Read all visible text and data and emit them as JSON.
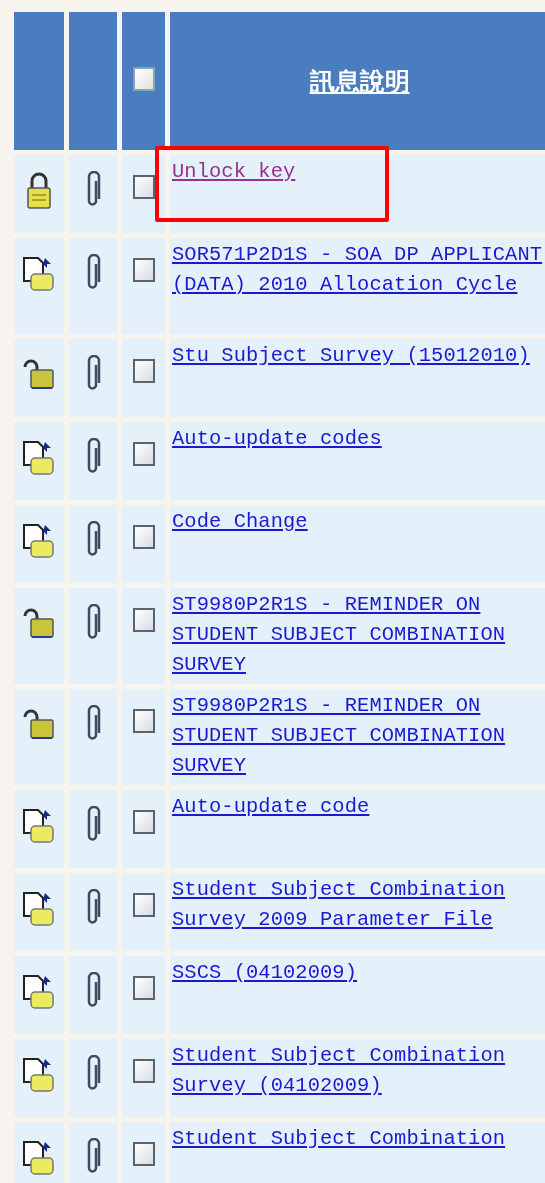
{
  "header": {
    "title": "訊息說明",
    "select_all_checked": false
  },
  "rows": [
    {
      "kind": "locked",
      "text": "Unlock key",
      "visited": true,
      "checked": false,
      "highlighted": true
    },
    {
      "kind": "document",
      "text": "SOR571P2D1S - SOA DP APPLICANT (DATA) 2010 Allocation Cycle",
      "visited": false,
      "checked": false,
      "highlighted": false
    },
    {
      "kind": "unlocked",
      "text": "Stu Subject Survey (15012010)",
      "visited": false,
      "checked": false,
      "highlighted": false
    },
    {
      "kind": "document",
      "text": "Auto-update codes",
      "visited": false,
      "checked": false,
      "highlighted": false
    },
    {
      "kind": "document",
      "text": "Code Change",
      "visited": false,
      "checked": false,
      "highlighted": false
    },
    {
      "kind": "unlocked",
      "text": "ST9980P2R1S - REMINDER ON STUDENT SUBJECT COMBINATION SURVEY",
      "visited": false,
      "checked": false,
      "highlighted": false
    },
    {
      "kind": "unlocked",
      "text": "ST9980P2R1S - REMINDER ON STUDENT SUBJECT COMBINATION SURVEY",
      "visited": false,
      "checked": false,
      "highlighted": false
    },
    {
      "kind": "document",
      "text": "Auto-update code",
      "visited": false,
      "checked": false,
      "highlighted": false
    },
    {
      "kind": "document",
      "text": "Student Subject Combination Survey 2009 Parameter File",
      "visited": false,
      "checked": false,
      "highlighted": false
    },
    {
      "kind": "document",
      "text": "SSCS (04102009)",
      "visited": false,
      "checked": false,
      "highlighted": false
    },
    {
      "kind": "document",
      "text": "Student Subject Combination Survey (04102009)",
      "visited": false,
      "checked": false,
      "highlighted": false
    },
    {
      "kind": "document",
      "text": "Student Subject Combination",
      "visited": false,
      "checked": false,
      "highlighted": false
    }
  ]
}
